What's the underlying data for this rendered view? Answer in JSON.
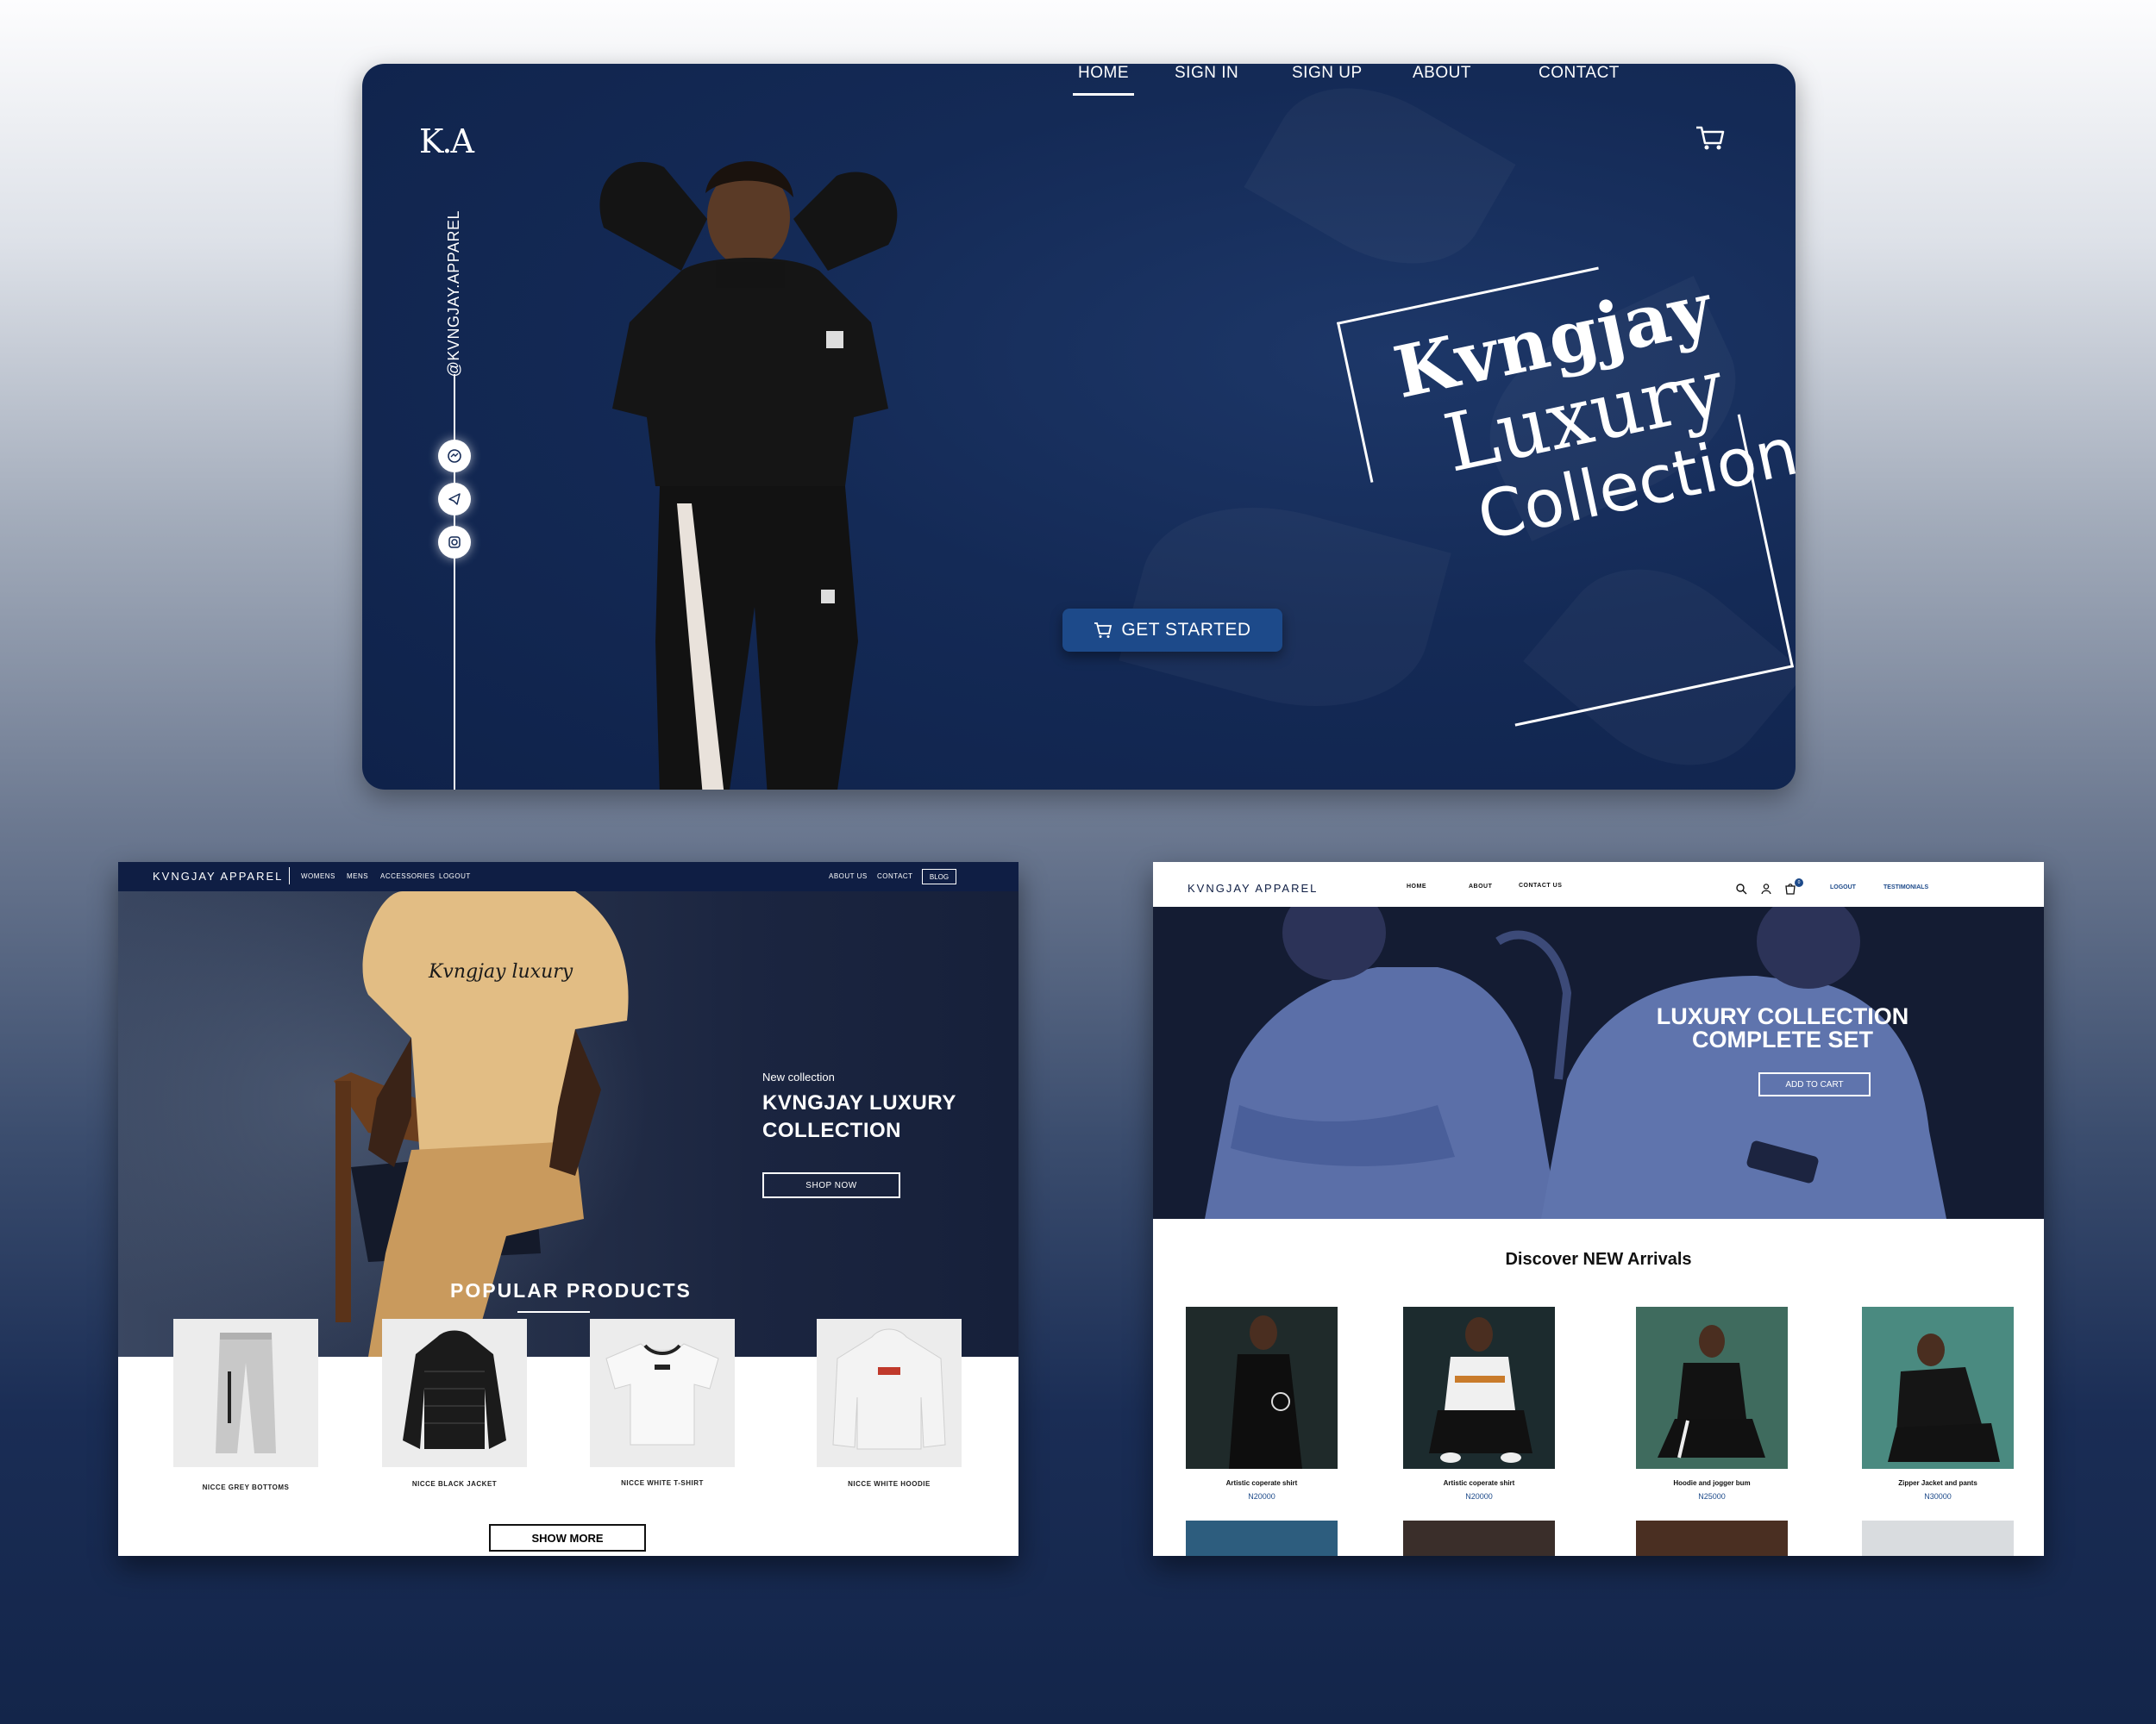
{
  "hero": {
    "logo": "K.A",
    "nav": [
      "HOME",
      "SIGN IN",
      "SIGN UP",
      "ABOUT",
      "CONTACT"
    ],
    "active_nav": "HOME",
    "handle": "@KVNGJAY.APPAREL",
    "social_icons": [
      "messenger-icon",
      "telegram-icon",
      "instagram-icon"
    ],
    "title_line1": "Kvngjay",
    "title_line2": "Luxury",
    "title_line3": "Collection",
    "cta": "GET STARTED",
    "colors": {
      "background": "#142a56",
      "button": "#1d4a8a",
      "text": "#ffffff"
    }
  },
  "shop_left": {
    "brand": "KVNGJAY APPAREL",
    "nav_left": [
      "WOMENS",
      "MENS",
      "ACCESSORIES",
      "LOGOUT"
    ],
    "nav_right": [
      "ABOUT US",
      "CONTACT"
    ],
    "blog": "BLOG",
    "banner_kicker": "New collection",
    "banner_title": "KVNGJAY LUXURY COLLECTION",
    "shop_now": "SHOP NOW",
    "section_title": "POPULAR PRODUCTS",
    "products": [
      {
        "name": "NICCE GREY BOTTOMS"
      },
      {
        "name": "NICCE BLACK JACKET"
      },
      {
        "name": "NICCE WHITE T-SHIRT"
      },
      {
        "name": "NICCE WHITE HOODIE"
      }
    ],
    "show_more": "SHOW MORE",
    "colors": {
      "topbar": "#0f1e44"
    }
  },
  "shop_right": {
    "brand": "KVNGJAY APPAREL",
    "nav": [
      "HOME",
      "ABOUT",
      "CONTACT US"
    ],
    "cart_count": "0",
    "logout": "LOGOUT",
    "testimonials": "TESTIMONIALS",
    "banner_title_1": "LUXURY COLLECTION",
    "banner_title_2": "COMPLETE SET",
    "add_to_cart": "ADD TO CART",
    "section_title": "Discover NEW Arrivals",
    "arrivals": [
      {
        "name": "Artistic coperate shirt",
        "price": "N20000"
      },
      {
        "name": "Artistic coperate shirt",
        "price": "N20000"
      },
      {
        "name": "Hoodie and jogger bum",
        "price": "N25000"
      },
      {
        "name": "Zipper Jacket and pants",
        "price": "N30000"
      }
    ],
    "colors": {
      "accent": "#1d4a8a",
      "banner_tint": "#4a5f9a"
    }
  }
}
